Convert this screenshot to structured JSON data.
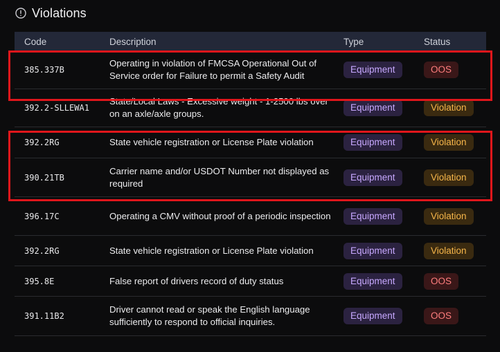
{
  "section": {
    "title": "Violations",
    "icon": "info-circle-icon"
  },
  "table": {
    "headers": {
      "code": "Code",
      "description": "Description",
      "type": "Type",
      "status": "Status"
    },
    "rows": [
      {
        "code": "385.337B",
        "description": "Operating in violation of FMCSA Operational Out of Service order for Failure to permit a Safety Audit",
        "type": "Equipment",
        "status": "OOS"
      },
      {
        "code": "392.2-SLLEWA1",
        "description": "State/Local Laws - Excessive weight - 1-2500 lbs over on an axle/axle groups.",
        "type": "Equipment",
        "status": "Violation"
      },
      {
        "code": "392.2RG",
        "description": "State vehicle registration or License Plate violation",
        "type": "Equipment",
        "status": "Violation"
      },
      {
        "code": "390.21TB",
        "description": "Carrier name and/or USDOT Number not displayed as required",
        "type": "Equipment",
        "status": "Violation"
      },
      {
        "code": "396.17C",
        "description": "Operating a CMV without proof of a periodic inspection",
        "type": "Equipment",
        "status": "Violation"
      },
      {
        "code": "392.2RG",
        "description": "State vehicle registration or License Plate violation",
        "type": "Equipment",
        "status": "Violation"
      },
      {
        "code": "395.8E",
        "description": "False report of drivers record of duty status",
        "type": "Equipment",
        "status": "OOS"
      },
      {
        "code": "391.11B2",
        "description": "Driver cannot read or speak the English language sufficiently to respond to official inquiries.",
        "type": "Equipment",
        "status": "OOS"
      }
    ]
  },
  "colors": {
    "background": "#0c0c0d",
    "header_bg": "#232838",
    "equipment_badge": "#c7a8ff",
    "oos_badge": "#ff7e7e",
    "violation_badge": "#f7b64a",
    "highlight_border": "#e0161b"
  }
}
